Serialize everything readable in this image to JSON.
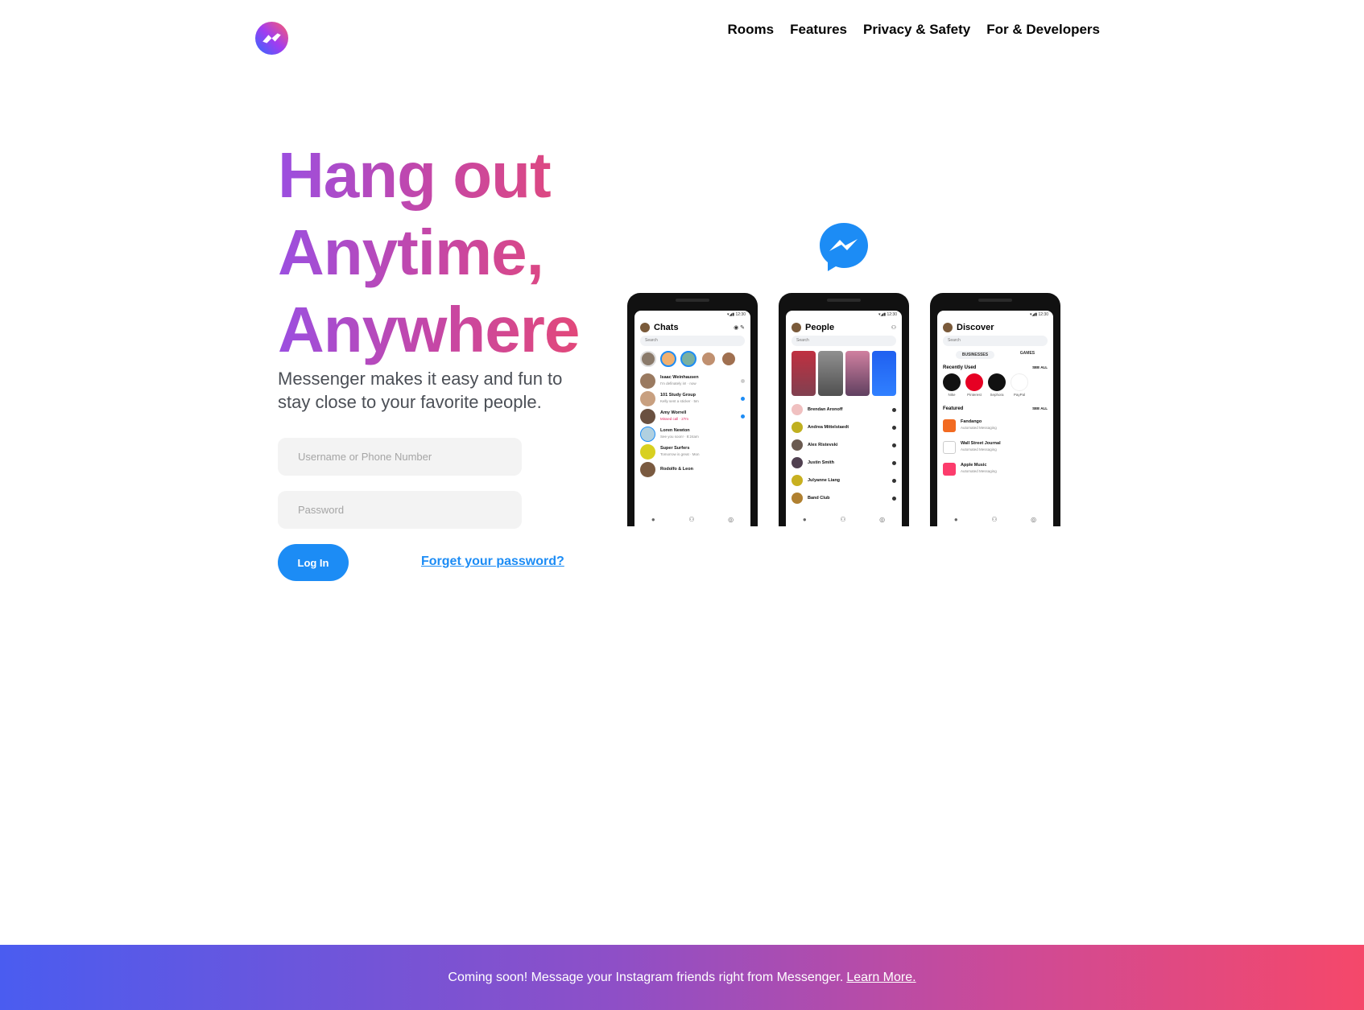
{
  "nav": {
    "items": [
      "Rooms",
      "Features",
      "Privacy & Safety",
      "For & Developers"
    ]
  },
  "hero": {
    "headline": [
      "Hang out",
      "Anytime,",
      "Anywhere"
    ],
    "subtitle": "Messenger makes it easy and fun to stay close to your favorite people."
  },
  "login": {
    "username_placeholder": "Username or Phone Number",
    "password_placeholder": "Password",
    "login_label": "Log In",
    "forgot_label": "Forget your password?"
  },
  "phones": {
    "chats": {
      "title": "Chats",
      "search": "Search",
      "rows": [
        {
          "name": "Isaac Weinhausen",
          "sub": "I'm definately in! · now"
        },
        {
          "name": "101 Study Group",
          "sub": "Kelly sent a sticker · 5m"
        },
        {
          "name": "Amy Worrell",
          "sub": "Missed call · 27m"
        },
        {
          "name": "Loren Newton",
          "sub": "See you soon! · 8:24am"
        },
        {
          "name": "Super Surfers",
          "sub": "Tomorrow is great · Mon"
        },
        {
          "name": "Rodolfo & Leon",
          "sub": ""
        }
      ]
    },
    "people": {
      "title": "People",
      "search": "Search",
      "rows": [
        "Brendan Aronoff",
        "Andrea Mittelstaedt",
        "Alex Ristevski",
        "Justin Smith",
        "Julyanne Liang",
        "Band Club"
      ]
    },
    "discover": {
      "title": "Discover",
      "search": "Search",
      "seg_businesses": "BUSINESSES",
      "seg_games": "GAMES",
      "recent_title": "Recently Used",
      "see_all": "SEE ALL",
      "recent": [
        "Nike",
        "Pinterest",
        "Sephora",
        "PayPal"
      ],
      "featured_title": "Featured",
      "featured": [
        {
          "name": "Fandango",
          "sub": "Automated Messaging"
        },
        {
          "name": "Wall Street Journal",
          "sub": "Automated Messaging"
        },
        {
          "name": "Apple Music",
          "sub": "Automated Messaging"
        }
      ]
    }
  },
  "footer": {
    "text": "Coming soon! Message your Instagram friends right from Messenger.",
    "link": "Learn More."
  }
}
